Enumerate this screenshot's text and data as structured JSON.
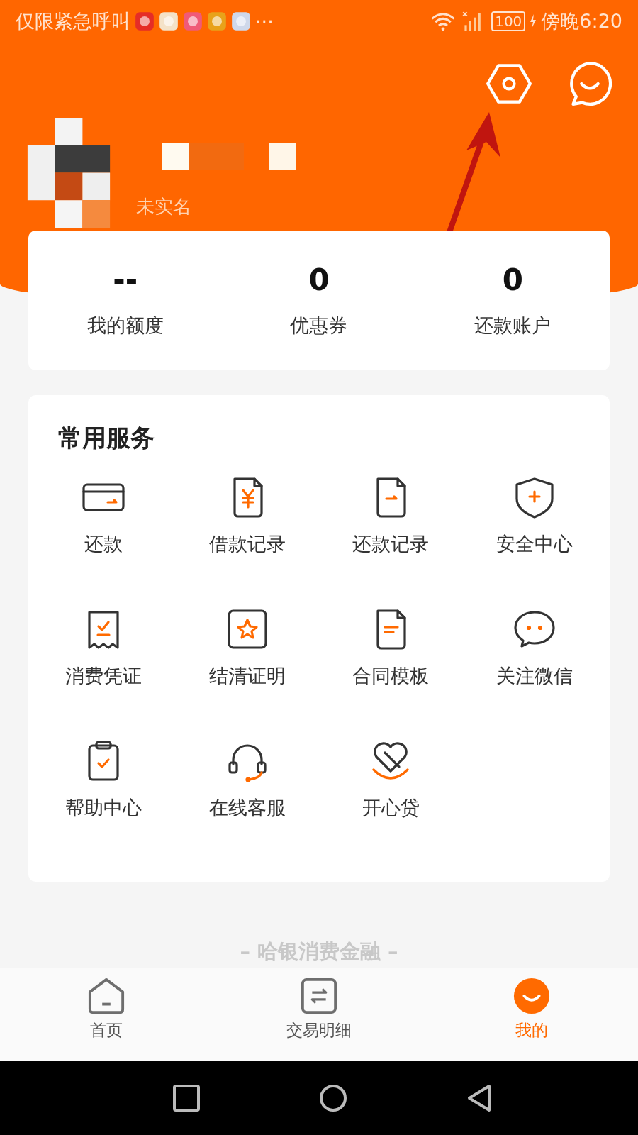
{
  "status_bar": {
    "carrier": "仅限紧急呼叫",
    "more": "···",
    "battery": "100",
    "time": "傍晚6:20"
  },
  "profile": {
    "status": "未实名"
  },
  "stats": [
    {
      "value": "--",
      "label": "我的额度"
    },
    {
      "value": "0",
      "label": "优惠券"
    },
    {
      "value": "0",
      "label": "还款账户"
    }
  ],
  "services": {
    "title": "常用服务",
    "items": [
      {
        "label": "还款",
        "kind": "card"
      },
      {
        "label": "借款记录",
        "kind": "yen-doc"
      },
      {
        "label": "还款记录",
        "kind": "arrow-doc"
      },
      {
        "label": "安全中心",
        "kind": "shield"
      },
      {
        "label": "消费凭证",
        "kind": "receipt"
      },
      {
        "label": "结清证明",
        "kind": "star"
      },
      {
        "label": "合同模板",
        "kind": "lines-doc"
      },
      {
        "label": "关注微信",
        "kind": "chat"
      },
      {
        "label": "帮助中心",
        "kind": "clipboard"
      },
      {
        "label": "在线客服",
        "kind": "headset"
      },
      {
        "label": "开心贷",
        "kind": "heart"
      }
    ]
  },
  "footer": "– 哈银消费金融 –",
  "tabs": [
    {
      "label": "首页",
      "kind": "home",
      "selected": false
    },
    {
      "label": "交易明细",
      "kind": "swap",
      "selected": false
    },
    {
      "label": "我的",
      "kind": "me",
      "selected": true
    }
  ]
}
